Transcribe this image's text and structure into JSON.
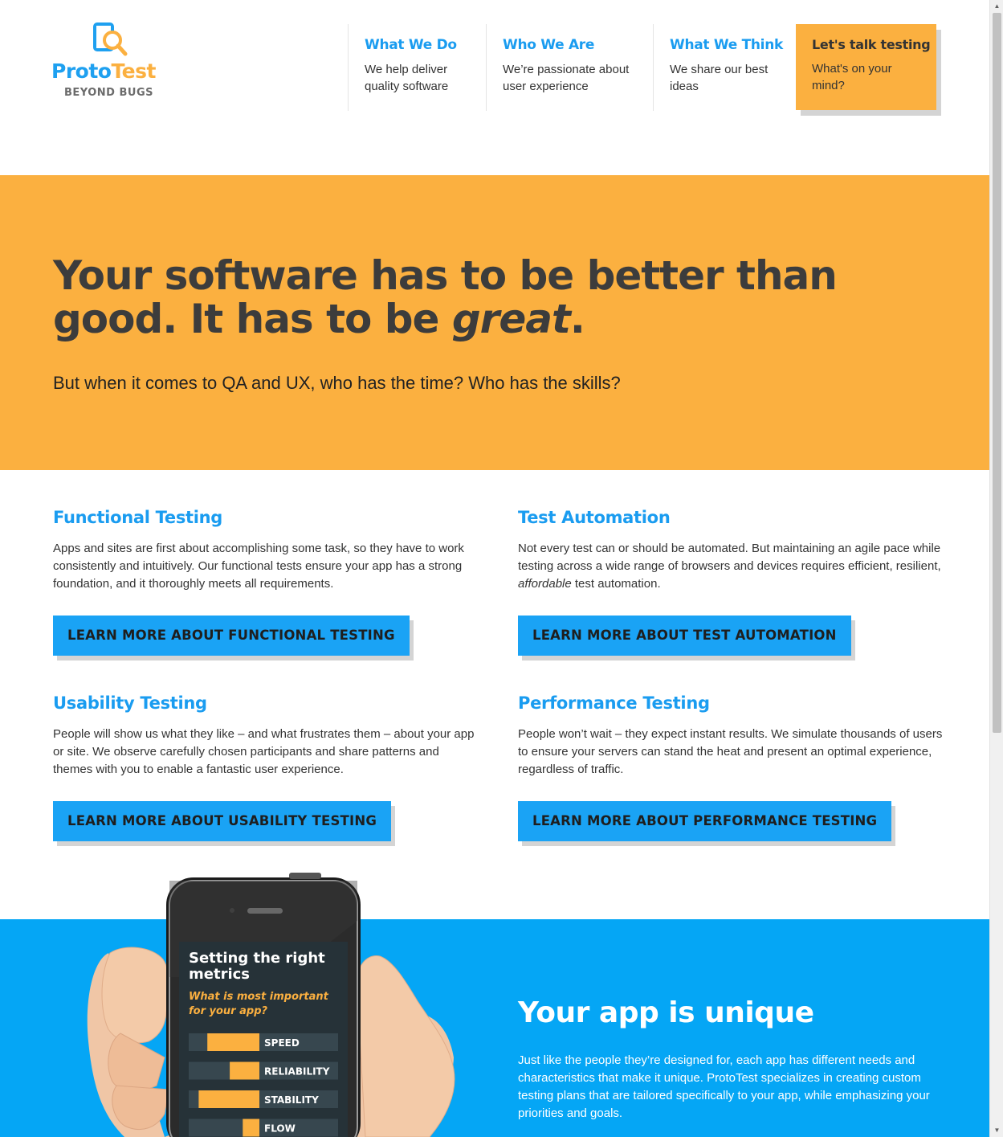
{
  "logo": {
    "proto": "Proto",
    "test": "Test",
    "tagline": "BEYOND BUGS"
  },
  "nav": [
    {
      "title": "What We Do",
      "desc": "We help deliver quality software"
    },
    {
      "title": "Who We Are",
      "desc": "We’re passionate about user experience"
    },
    {
      "title": "What We Think",
      "desc": "We share our best ideas"
    }
  ],
  "cta": {
    "title": "Let's talk testing",
    "desc": "What's on your mind?"
  },
  "hero": {
    "headline_main": "Your software has to be better than good. It has to be ",
    "headline_em": "great",
    "headline_end": ".",
    "subtitle": "But when it comes to QA and UX, who has the time? Who has the skills?"
  },
  "services": [
    {
      "title": "Functional Testing",
      "desc": "Apps and sites are first about accomplishing some task, so they have to work consistently and intuitively. Our functional tests ensure your app has a strong foundation, and it thoroughly meets all requirements.",
      "button": "LEARN MORE ABOUT FUNCTIONAL TESTING"
    },
    {
      "title": "Test Automation",
      "desc_pre": "Not every test can or should be automated. But maintaining an agile pace while testing across a wide range of browsers and devices requires efficient, resilient, ",
      "desc_em": "affordable",
      "desc_post": " test automation.",
      "button": "LEARN MORE ABOUT TEST AUTOMATION"
    },
    {
      "title": "Usability Testing",
      "desc": "People will show us what they like – and what frustrates them – about your app or site. We observe carefully chosen participants and share patterns and themes with you to enable a fantastic user experience.",
      "button": "LEARN MORE ABOUT USABILITY TESTING"
    },
    {
      "title": "Performance Testing",
      "desc": "People won’t wait – they expect instant results. We simulate thousands of users to ensure your servers can stand the heat and present an optimal experience, regardless of traffic.",
      "button": "LEARN MORE ABOUT PERFORMANCE TESTING"
    }
  ],
  "unique": {
    "title": "Your app is unique",
    "desc": "Just like the people they’re designed for, each app has different needs and characteristics that make it unique. ProtoTest specializes in creating custom testing plans that are tailored specifically to your app, while emphasizing your priorities and goals."
  },
  "phone_screen": {
    "title_line1": "Setting the right",
    "title_line2": "metrics",
    "subtitle_line1": "What is most important",
    "subtitle_line2": "for your app?",
    "metrics": [
      {
        "label": "SPEED",
        "level": 0.72
      },
      {
        "label": "RELIABILITY",
        "level": 0.41
      },
      {
        "label": "STABILITY",
        "level": 0.84
      },
      {
        "label": "FLOW",
        "level": 0.23
      }
    ]
  },
  "colors": {
    "blue": "#1a9cf0",
    "orange": "#fbb040",
    "dark": "#3c3c3c",
    "section_blue": "#05a6f5"
  },
  "icons": [
    "magnifier-logo-icon",
    "scroll-up-icon",
    "scroll-down-icon"
  ]
}
